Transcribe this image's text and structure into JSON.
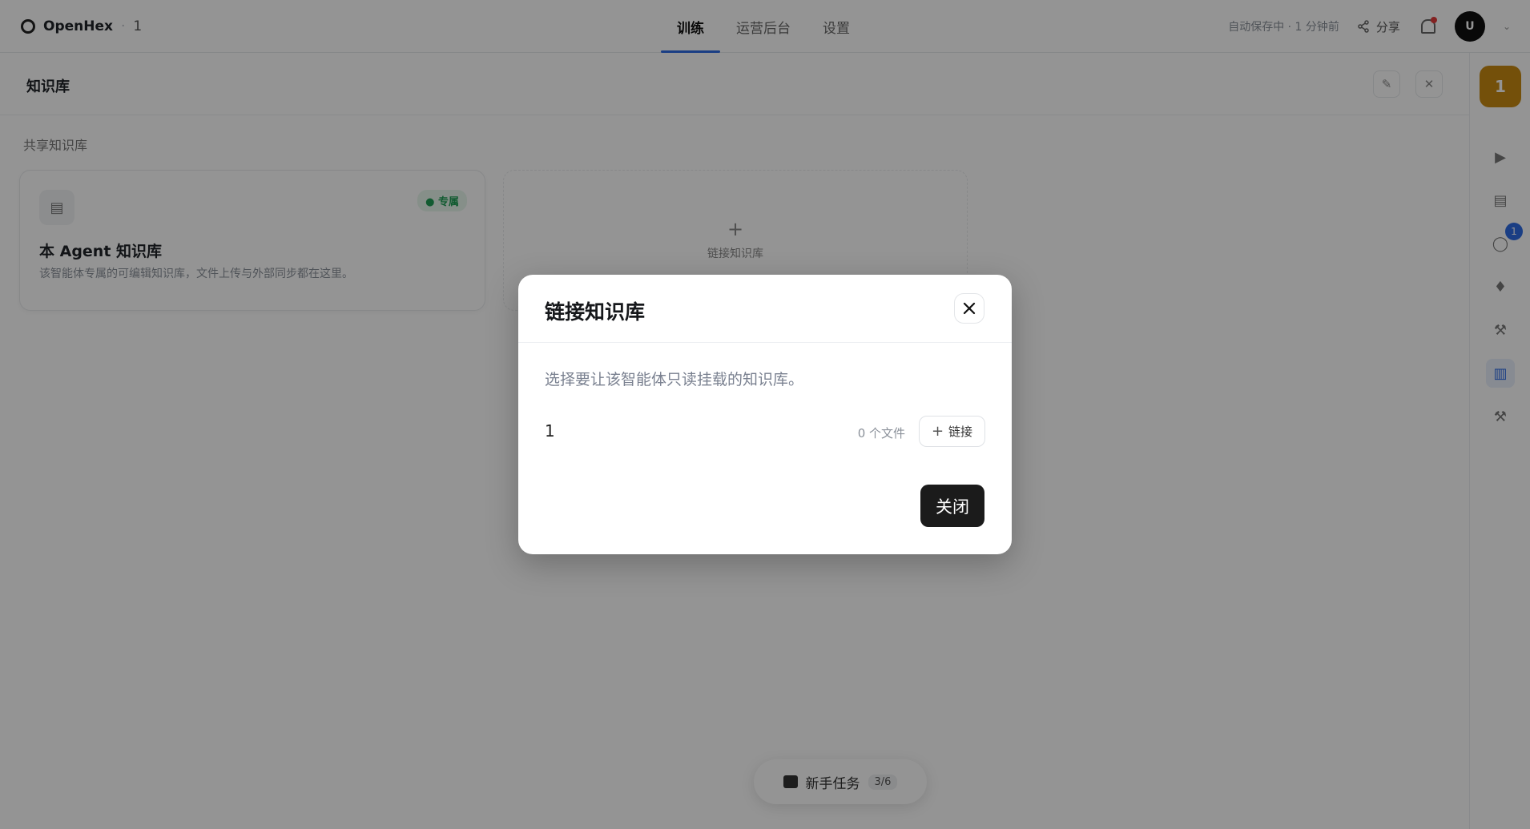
{
  "brand": {
    "name": "OpenHex",
    "separator": "·",
    "crumb": "1"
  },
  "tabs": [
    {
      "label": "训练"
    },
    {
      "label": "运营后台"
    },
    {
      "label": "设置"
    }
  ],
  "topbar": {
    "autosave": "自动保存中 · 1 分钟前",
    "share_label": "分享",
    "avatar_initial": "U",
    "caret": "⌄"
  },
  "subheader": {
    "title": "知识库",
    "edit_icon": "✎",
    "close_icon": "✕"
  },
  "content": {
    "section_label": "共享知识库",
    "kb_card": {
      "icon": "▤",
      "badge": "● 专属",
      "title": "本 Agent 知识库",
      "desc": "该智能体专属的可编辑知识库，文件上传与外部同步都在这里。"
    },
    "link_card": {
      "plus": "+",
      "label": "链接知识库"
    }
  },
  "rail": {
    "avatar": "1",
    "buttons": [
      {
        "icon": "▶"
      },
      {
        "icon": "▤"
      },
      {
        "icon": "◯",
        "badge": "1"
      },
      {
        "icon": "♦"
      },
      {
        "icon": "⚒"
      },
      {
        "icon": "▥"
      },
      {
        "icon": "⚒"
      }
    ]
  },
  "tasks_pill": {
    "label": "新手任务",
    "tag": "3/6"
  },
  "modal": {
    "title": "链接知识库",
    "close_icon": "✕",
    "description": "选择要让该智能体只读挂载的知识库。",
    "kb_item": {
      "name": "1",
      "file_count": "0 个文件",
      "link_plus": "+",
      "link_label": "链接"
    },
    "close_button": "关闭"
  }
}
